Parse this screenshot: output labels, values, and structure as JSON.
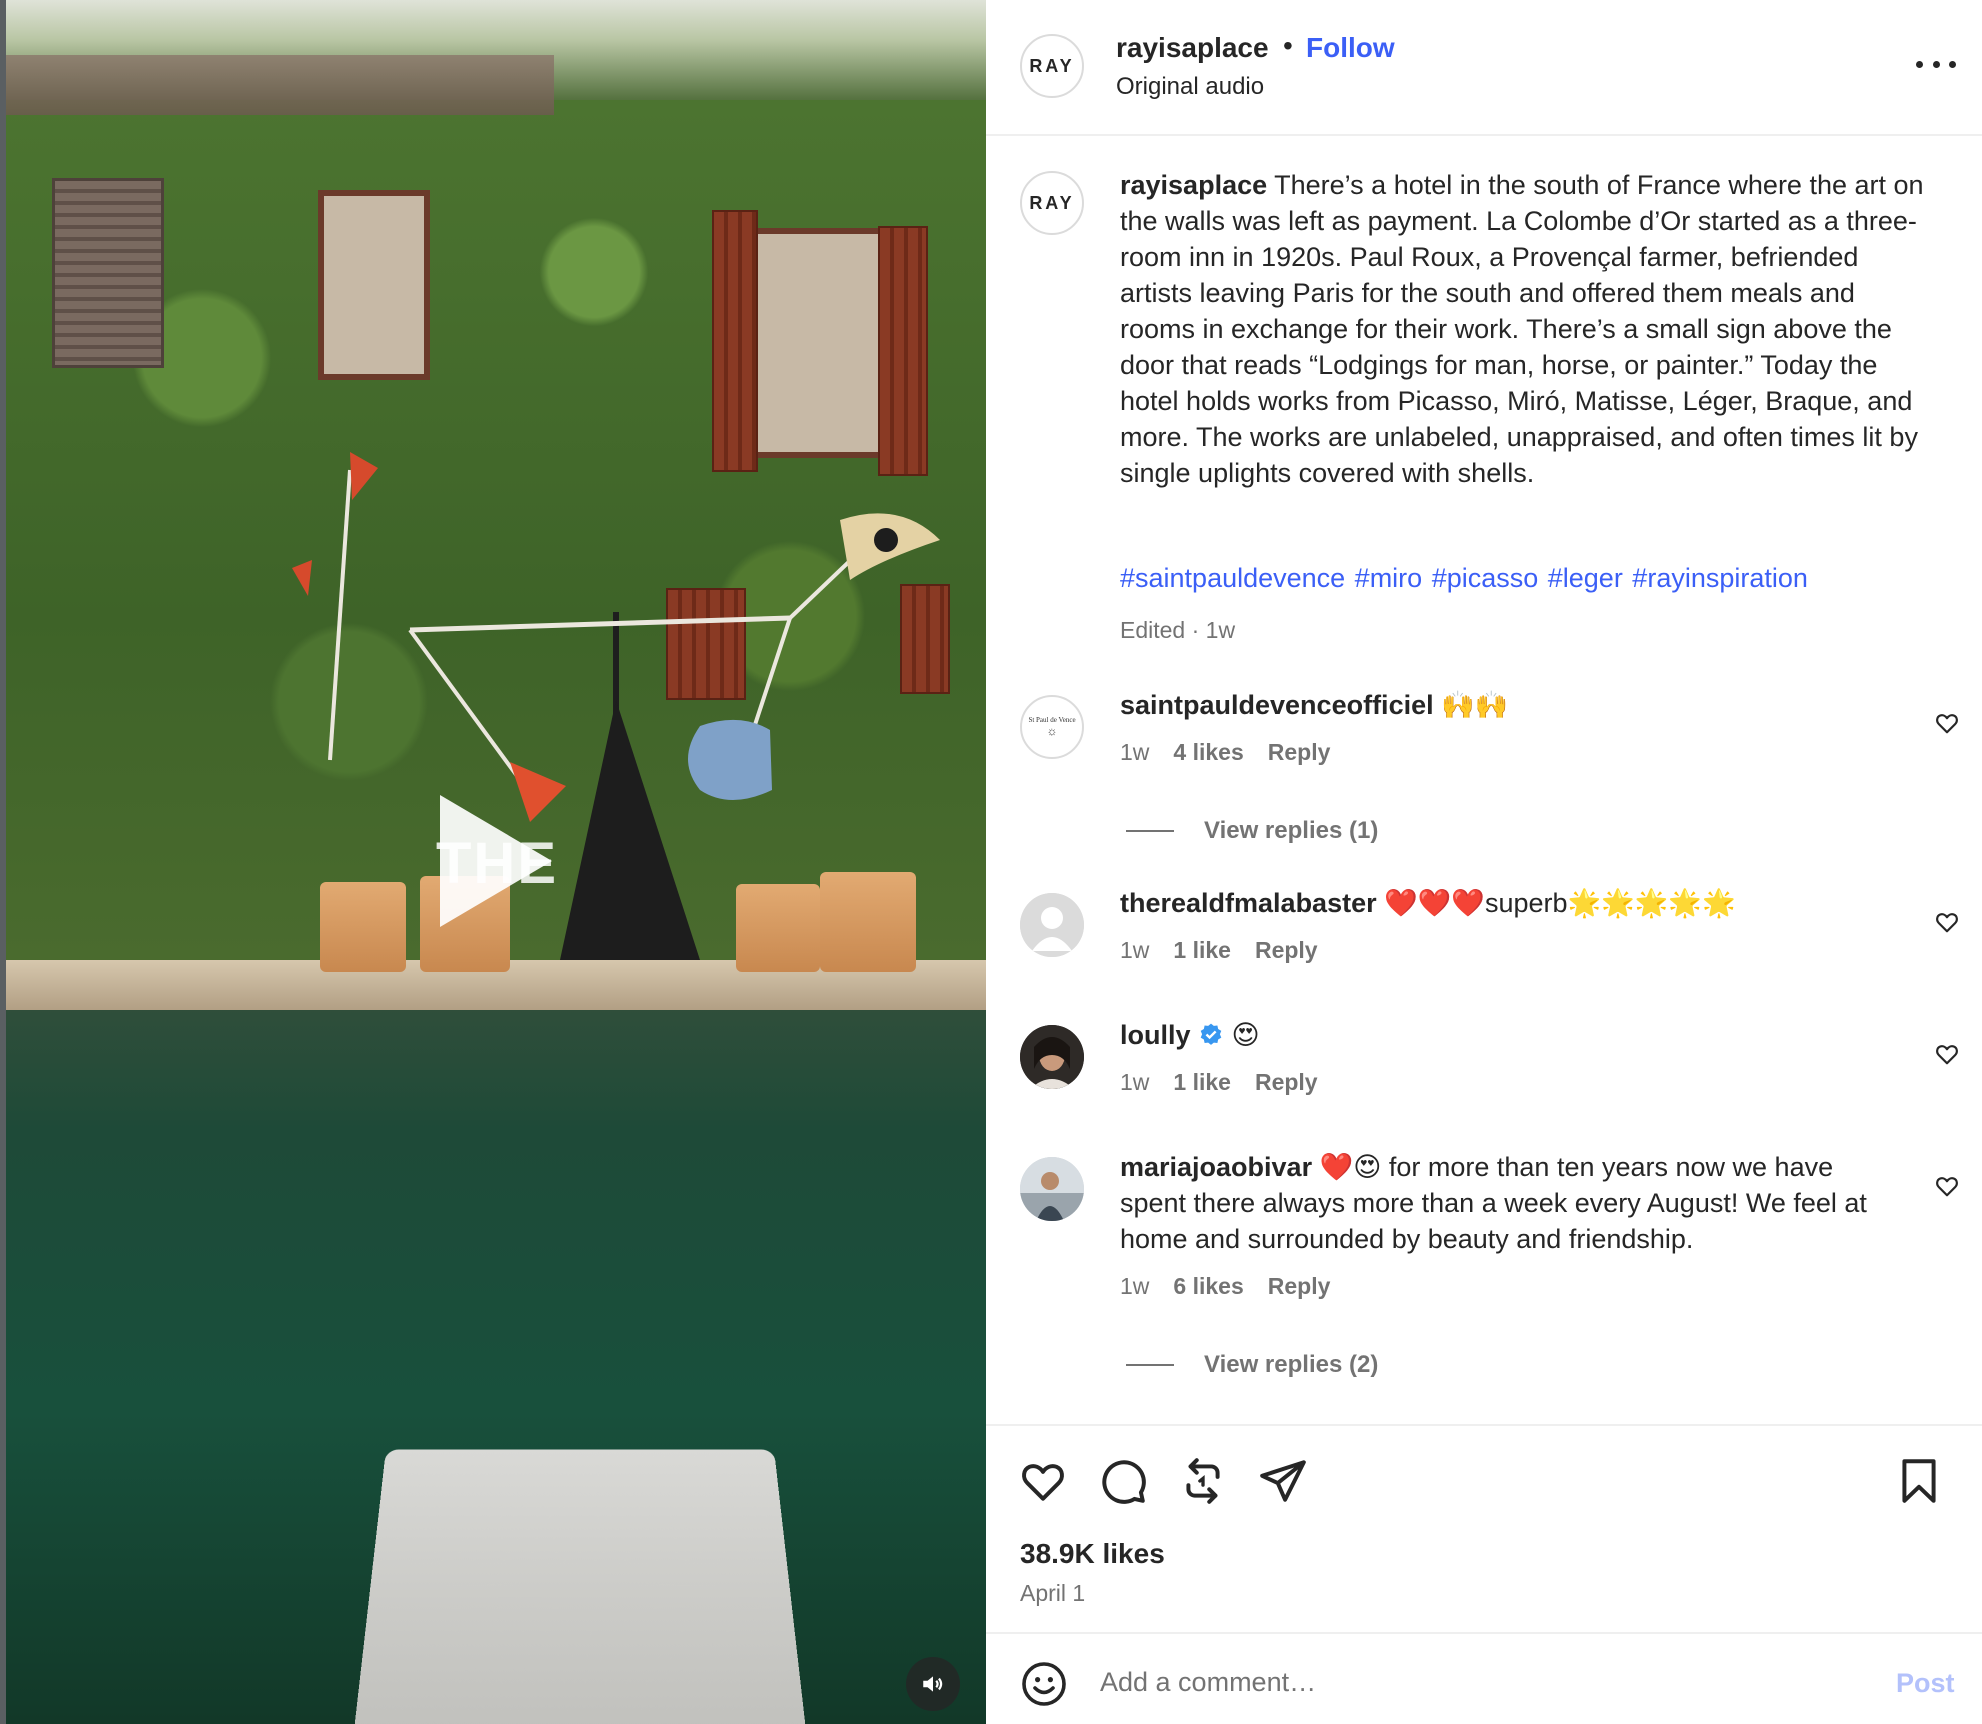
{
  "post": {
    "username": "rayisaplace",
    "follow_label": "Follow",
    "audio_label": "Original audio",
    "avatar_text": "RAY",
    "video_overlay_text": "THE"
  },
  "caption": {
    "username": "rayisaplace",
    "text": "There’s a hotel in the south of France where the art on the walls was left as payment. La Colombe d’Or started as a three-room inn in 1920s. Paul Roux, a Provençal farmer, befriended artists leaving Paris for the south and offered them meals and rooms in exchange for their work. There’s a small sign above the door that reads “Lodgings for man, horse, or painter.” Today the hotel holds works from Picasso, Miró, Matisse, Léger, Braque, and more. The works are unlabeled, unappraised, and often times lit by single uplights covered with shells.",
    "hashtags": "#saintpauldevence #miro #picasso #leger #rayinspiration",
    "edited": "Edited · 1w"
  },
  "comments": [
    {
      "username": "saintpauldevenceofficiel",
      "text": "🙌🙌",
      "time": "1w",
      "likes": "4 likes",
      "reply": "Reply",
      "view_replies": "View replies (1)",
      "avatar_text": "St Paul de Vence"
    },
    {
      "username": "therealdfmalabaster",
      "text": "❤️❤️❤️superb🌟🌟🌟🌟🌟",
      "time": "1w",
      "likes": "1 like",
      "reply": "Reply"
    },
    {
      "username": "loully",
      "text": "😍",
      "time": "1w",
      "likes": "1 like",
      "reply": "Reply"
    },
    {
      "username": "mariajoaobivar",
      "text": "❤️😍 for more than ten years now we have spent there always more than a week every August! We feel at home and surrounded by beauty and friendship.",
      "time": "1w",
      "likes": "6 likes",
      "reply": "Reply",
      "view_replies": "View replies (2)"
    }
  ],
  "stats": {
    "likes": "38.9K likes",
    "date": "April 1"
  },
  "composer": {
    "placeholder": "Add a comment…",
    "post_label": "Post"
  },
  "icons": {
    "like": "heart-icon",
    "comment": "comment-icon",
    "repost": "repost-icon",
    "share": "send-icon",
    "save": "bookmark-icon",
    "emoji": "emoji-icon",
    "more": "more-icon",
    "sound": "speaker-icon",
    "verified": "verified-badge-icon",
    "play": "play-icon"
  },
  "colors": {
    "link_blue": "#3b5ff6",
    "muted_text": "#737373",
    "post_disabled": "#b3c1fb",
    "verified": "#3897f0"
  }
}
